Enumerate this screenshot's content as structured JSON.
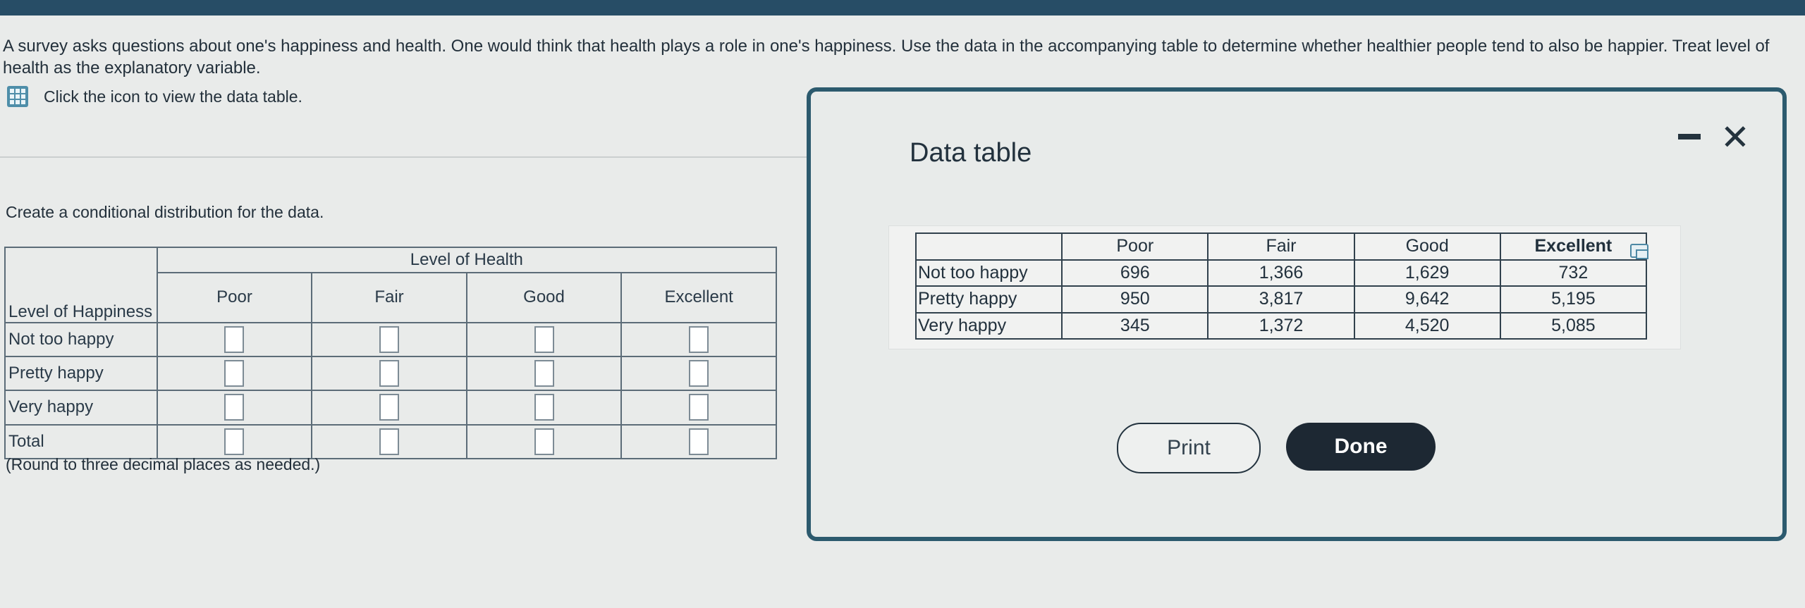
{
  "question": {
    "text": "A survey asks questions about one's happiness and health. One would think that health plays a role in one's happiness. Use the data in the accompanying table to determine whether healthier people tend to also be happier. Treat level of health as the explanatory variable.",
    "hint": "Click the icon to view the data table."
  },
  "answer": {
    "prompt": "Create a conditional distribution for the data.",
    "table_title": "Level of Health",
    "row_header": "Level of Happiness",
    "columns": [
      "Poor",
      "Fair",
      "Good",
      "Excellent"
    ],
    "rows": [
      "Not too happy",
      "Pretty happy",
      "Very happy",
      "Total"
    ],
    "note": "(Round to three decimal places as needed.)"
  },
  "modal": {
    "title": "Data table",
    "columns": [
      "Poor",
      "Fair",
      "Good",
      "Excellent"
    ],
    "rows": [
      {
        "label": "Not too happy",
        "values": [
          "696",
          "1,366",
          "1,629",
          "732"
        ]
      },
      {
        "label": "Pretty happy",
        "values": [
          "950",
          "3,817",
          "9,642",
          "5,195"
        ]
      },
      {
        "label": "Very happy",
        "values": [
          "345",
          "1,372",
          "4,520",
          "5,085"
        ]
      }
    ],
    "close_glyph": "✕",
    "print_label": "Print",
    "done_label": "Done"
  },
  "icons": {
    "data_table": "grid-icon",
    "minimize": "minimize-icon",
    "close": "close-icon",
    "copy": "copy-icon"
  },
  "colors": {
    "topbar": "#274d66",
    "accent": "#4e8ea9",
    "done_button": "#1d2833"
  }
}
